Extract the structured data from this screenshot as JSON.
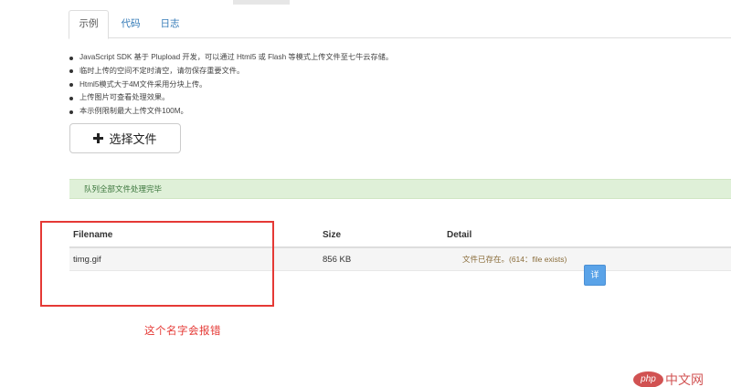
{
  "tabs": [
    {
      "label": "示例",
      "active": true
    },
    {
      "label": "代码",
      "active": false
    },
    {
      "label": "日志",
      "active": false
    }
  ],
  "notes": [
    "JavaScript SDK 基于 Plupload 开发，可以通过 Html5 或 Flash 等模式上传文件至七牛云存储。",
    "临时上传的空间不定时清空，请勿保存重要文件。",
    "Html5模式大于4M文件采用分块上传。",
    "上传图片可查看处理效果。",
    "本示例限制最大上传文件100M。"
  ],
  "select_button": {
    "label": "选择文件",
    "icon": "plus-icon"
  },
  "status_alert": "队列全部文件处理完毕",
  "table": {
    "headers": {
      "filename": "Filename",
      "size": "Size",
      "detail": "Detail"
    },
    "rows": [
      {
        "filename": "timg.gif",
        "size": "856 KB",
        "detail": "文件已存在。(614：file exists)"
      }
    ]
  },
  "detail_button": "详",
  "annotation": "这个名字会报错",
  "watermark": {
    "logo": "php",
    "text": "中文网"
  },
  "colors": {
    "link": "#337ab7",
    "alert_bg": "#dff0d8",
    "alert_text": "#3c763d",
    "warning_text": "#8a6d3b",
    "detail_button": "#5aa3e8",
    "annotation_red": "#e53935"
  }
}
